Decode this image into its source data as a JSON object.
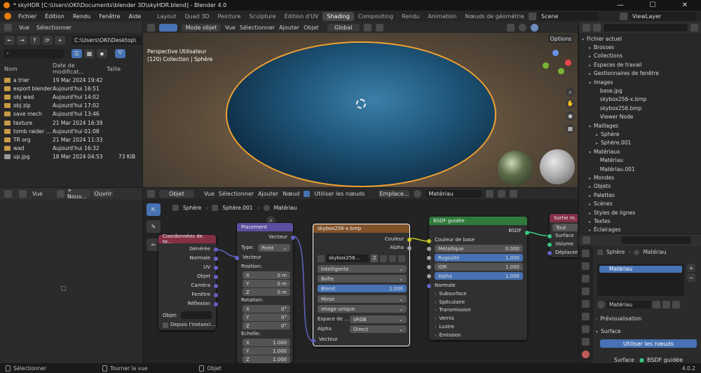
{
  "window": {
    "title": "* skyHDR [C:\\Users\\OKI\\Documents\\blender 3D\\skyHDR.blend] - Blender 4.0",
    "controls": [
      "—",
      "☐",
      "✕"
    ]
  },
  "menu": [
    "Fichier",
    "Édition",
    "Rendu",
    "Fenêtre",
    "Aide"
  ],
  "workspaces": [
    "Layout",
    "Quad 3D",
    "Peinture",
    "Sculpture",
    "Édition d'UV",
    "Shading",
    "Compositing",
    "Rendu",
    "Animation",
    "Nœuds de géométrie",
    "Scripting"
  ],
  "active_workspace": "Shading",
  "scene": {
    "scene_label": "Scene",
    "viewlayer_label": "ViewLayer"
  },
  "filebrowser": {
    "menu": [
      "Vue",
      "Sélectionner"
    ],
    "path": "C:\\Users\\OKI\\Desktop\\",
    "columns": [
      "Nom",
      "Date de modificat...",
      "Taille"
    ],
    "rows": [
      {
        "name": "a trier",
        "date": "19 Mar 2024 19:42",
        "size": "",
        "type": "folder"
      },
      {
        "name": "export blender",
        "date": "Aujourd'hui 16:51",
        "size": "",
        "type": "folder"
      },
      {
        "name": "obj wad",
        "date": "Aujourd'hui 14:02",
        "size": "",
        "type": "folder"
      },
      {
        "name": "obj zip",
        "date": "Aujourd'hui 17:02",
        "size": "",
        "type": "folder"
      },
      {
        "name": "save mech",
        "date": "Aujourd'hui 13:46",
        "size": "",
        "type": "folder"
      },
      {
        "name": "texture",
        "date": "21 Mar 2024 16:39",
        "size": "",
        "type": "folder"
      },
      {
        "name": "tomb raider ...",
        "date": "Aujourd'hui 01:08",
        "size": "",
        "type": "folder"
      },
      {
        "name": "TR org",
        "date": "21 Mar 2024 11:33",
        "size": "",
        "type": "folder"
      },
      {
        "name": "wad",
        "date": "Aujourd'hui 16:32",
        "size": "",
        "type": "folder"
      },
      {
        "name": "up.jpg",
        "date": "18 Mar 2024 04:53",
        "size": "73 KiB",
        "type": "image"
      }
    ]
  },
  "imageeditor": {
    "view": "Vue",
    "new": "+ Nouv...",
    "open": "Ouvrir"
  },
  "viewport": {
    "mode": "Mode objet",
    "menu": [
      "Vue",
      "Sélectionner",
      "Ajouter",
      "Objet"
    ],
    "transform": "Global",
    "overlay1": "Perspective Utilisateur",
    "overlay2": "(120) Collection | Sphère",
    "options": "Options"
  },
  "nodeeditor": {
    "type": "Objet",
    "menu": [
      "Vue",
      "Sélectionner",
      "Ajouter",
      "Nœud"
    ],
    "use_nodes": "Utiliser les nœuds",
    "slot": "Emplace...",
    "material": "Matériau",
    "breadcrumb": [
      "Sphère",
      "Sphère.001",
      "Matériau"
    ]
  },
  "node_texcoord": {
    "title": "Coordonnées de te...",
    "outputs": [
      "Générée",
      "Normale",
      "UV",
      "Objet",
      "Caméra",
      "Fenêtre",
      "Réflexion"
    ],
    "object_label": "Objet:",
    "from_instancer": "Depuis l'instanci..."
  },
  "node_mapping": {
    "title": "Placement",
    "out": "Vecteur",
    "type_label": "Type:",
    "type_value": "Point",
    "vector": "Vecteur",
    "loc_label": "Position:",
    "loc": [
      {
        "a": "X",
        "v": "0 m"
      },
      {
        "a": "Y",
        "v": "0 m"
      },
      {
        "a": "Z",
        "v": "0 m"
      }
    ],
    "rot_label": "Rotation:",
    "rot": [
      {
        "a": "X",
        "v": "0°"
      },
      {
        "a": "Y",
        "v": "0°"
      },
      {
        "a": "Z",
        "v": "0°"
      }
    ],
    "scale_label": "Échelle:",
    "scale": [
      {
        "a": "X",
        "v": "1.000"
      },
      {
        "a": "Y",
        "v": "1.000"
      },
      {
        "a": "Z",
        "v": "1.000"
      }
    ]
  },
  "node_image": {
    "title": "skybox256-x.bmp",
    "out_color": "Couleur",
    "out_alpha": "Alpha",
    "image": "skybox256...",
    "users": "2",
    "interp": "Intelligente",
    "proj": "Boîte",
    "blend_label": "Blend",
    "blend_value": "1.000",
    "ext": "Miroir",
    "source": "Image unique",
    "cs_label": "Espace de ...",
    "cs_value": "sRGB",
    "alpha_label": "Alpha",
    "alpha_value": "Direct",
    "vector": "Vecteur"
  },
  "node_bsdf": {
    "title": "BSDF guidée",
    "out": "BSDF",
    "base": "Couleur de base",
    "fields": [
      {
        "label": "Métallique",
        "value": "0.000",
        "fill": 0
      },
      {
        "label": "Rugosité",
        "value": "1.000",
        "fill": 1
      },
      {
        "label": "IOR",
        "value": "1.000",
        "fill": 0
      },
      {
        "label": "Alpha",
        "value": "1.000",
        "fill": 1
      }
    ],
    "normal": "Normale",
    "subs": [
      "Subsurface",
      "Spéculaire",
      "Transmission",
      "Vernis",
      "Lustre",
      "Émission"
    ]
  },
  "node_output": {
    "title": "Sortie m...",
    "target": "Tout",
    "inputs": [
      "Surface",
      "Volume",
      "Déplacement"
    ]
  },
  "outliner": {
    "root": "Fichier actuel",
    "items": [
      {
        "label": "Brosses",
        "indent": 1,
        "exp": "▸"
      },
      {
        "label": "Collections",
        "indent": 1,
        "exp": "▸"
      },
      {
        "label": "Espaces de travail",
        "indent": 1,
        "exp": "▸"
      },
      {
        "label": "Gestionnaires de fenêtre",
        "indent": 1,
        "exp": "▸"
      },
      {
        "label": "Images",
        "indent": 1,
        "exp": "▾"
      },
      {
        "label": "base.jpg",
        "indent": 2,
        "exp": ""
      },
      {
        "label": "skybox256-x.bmp",
        "indent": 2,
        "exp": ""
      },
      {
        "label": "skybox256.bmp",
        "indent": 2,
        "exp": ""
      },
      {
        "label": "Viewer Node",
        "indent": 2,
        "exp": ""
      },
      {
        "label": "Maillages",
        "indent": 1,
        "exp": "▾"
      },
      {
        "label": "Sphère",
        "indent": 2,
        "exp": "▸"
      },
      {
        "label": "Sphère.001",
        "indent": 2,
        "exp": "▸"
      },
      {
        "label": "Matériaux",
        "indent": 1,
        "exp": "▾"
      },
      {
        "label": "Matériau",
        "indent": 2,
        "exp": ""
      },
      {
        "label": "Matériau.001",
        "indent": 2,
        "exp": ""
      },
      {
        "label": "Mondes",
        "indent": 1,
        "exp": "▸"
      },
      {
        "label": "Objets",
        "indent": 1,
        "exp": "▸"
      },
      {
        "label": "Palettes",
        "indent": 1,
        "exp": "▸"
      },
      {
        "label": "Scènes",
        "indent": 1,
        "exp": "▸"
      },
      {
        "label": "Styles de lignes",
        "indent": 1,
        "exp": "▸"
      },
      {
        "label": "Textes",
        "indent": 1,
        "exp": "▸"
      },
      {
        "label": "Éclairages",
        "indent": 1,
        "exp": "▸"
      }
    ]
  },
  "properties": {
    "breadcrumb": [
      "Sphère",
      "Matériau"
    ],
    "slot": "Matériau",
    "material": "Matériau",
    "preview": "Prévisualisation",
    "surface": "Surface",
    "use_nodes": "Utiliser les nœuds",
    "surface_label": "Surface",
    "surface_value": "BSDF guidée"
  },
  "statusbar": {
    "items": [
      "Sélectionner",
      "Tourner la vue",
      "Objet"
    ],
    "version": "4.0.2"
  }
}
